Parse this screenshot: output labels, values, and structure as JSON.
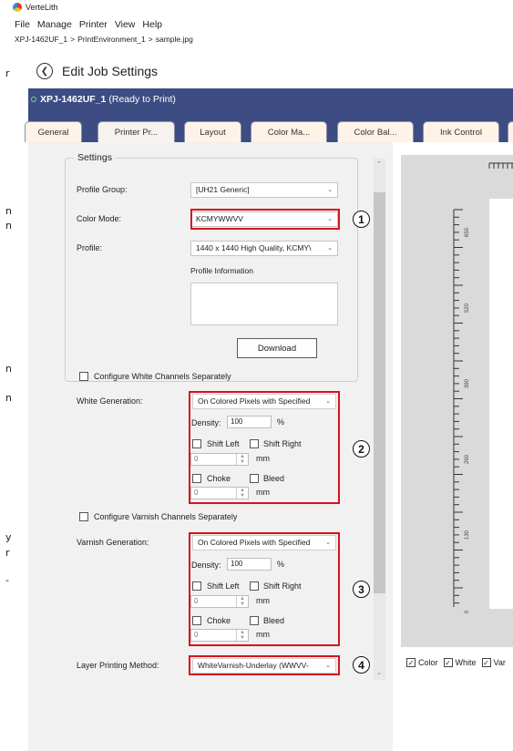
{
  "app": {
    "title": "VerteLith"
  },
  "menu": [
    "File",
    "Manage",
    "Printer",
    "View",
    "Help"
  ],
  "breadcrumb": [
    "XPJ-1462UF_1",
    ">",
    "PrintEnvironment_1",
    ">",
    "sample.jpg"
  ],
  "header": {
    "title": "Edit Job Settings"
  },
  "status": {
    "printer": "XPJ-1462UF_1",
    "state": "(Ready to Print)"
  },
  "tabs": [
    "General",
    "Printer Pr...",
    "Layout",
    "Color Ma...",
    "Color Bal...",
    "Ink Control"
  ],
  "margin_glyphs": [
    "r",
    "n",
    "n",
    "n",
    "n",
    "y",
    "r",
    "-"
  ],
  "settings": {
    "group_title": "Settings",
    "profile_group": {
      "label": "Profile Group:",
      "value": "[UH21 Generic]"
    },
    "color_mode": {
      "label": "Color Mode:",
      "value": "KCMYWWVV"
    },
    "profile": {
      "label": "Profile:",
      "value": "1440 x 1440 High Quality, KCMY\\"
    },
    "profile_info_label": "Profile Information",
    "download_label": "Download"
  },
  "white": {
    "configure_label": "Configure White Channels Separately",
    "generation_label": "White Generation:",
    "generation_value": "On Colored Pixels with Specified",
    "density_label": "Density:",
    "density_value": "100",
    "percent": "%",
    "shift_left": "Shift Left",
    "shift_right": "Shift Right",
    "shift_value": "0",
    "mm": "mm",
    "choke": "Choke",
    "bleed": "Bleed",
    "choke_value": "0"
  },
  "varnish": {
    "configure_label": "Configure Varnish Channels Separately",
    "generation_label": "Varnish Generation:",
    "generation_value": "On Colored Pixels with Specified",
    "density_label": "Density:",
    "density_value": "100",
    "percent": "%",
    "shift_left": "Shift Left",
    "shift_right": "Shift Right",
    "shift_value": "0",
    "mm": "mm",
    "choke": "Choke",
    "bleed": "Bleed",
    "choke_value": "0"
  },
  "layer": {
    "label": "Layer Printing Method:",
    "value": "WhiteVarnish-Underlay (WWVV-"
  },
  "callouts": [
    "1",
    "2",
    "3",
    "4"
  ],
  "preview": {
    "ruler_labels": [
      "650",
      "520",
      "390",
      "260",
      "130",
      "0"
    ],
    "checks": [
      "Color",
      "White",
      "Var"
    ]
  },
  "colors": {
    "header_bg": "#3d4c83",
    "highlight": "#d6121e",
    "tab_bg": "#fff3e8"
  }
}
